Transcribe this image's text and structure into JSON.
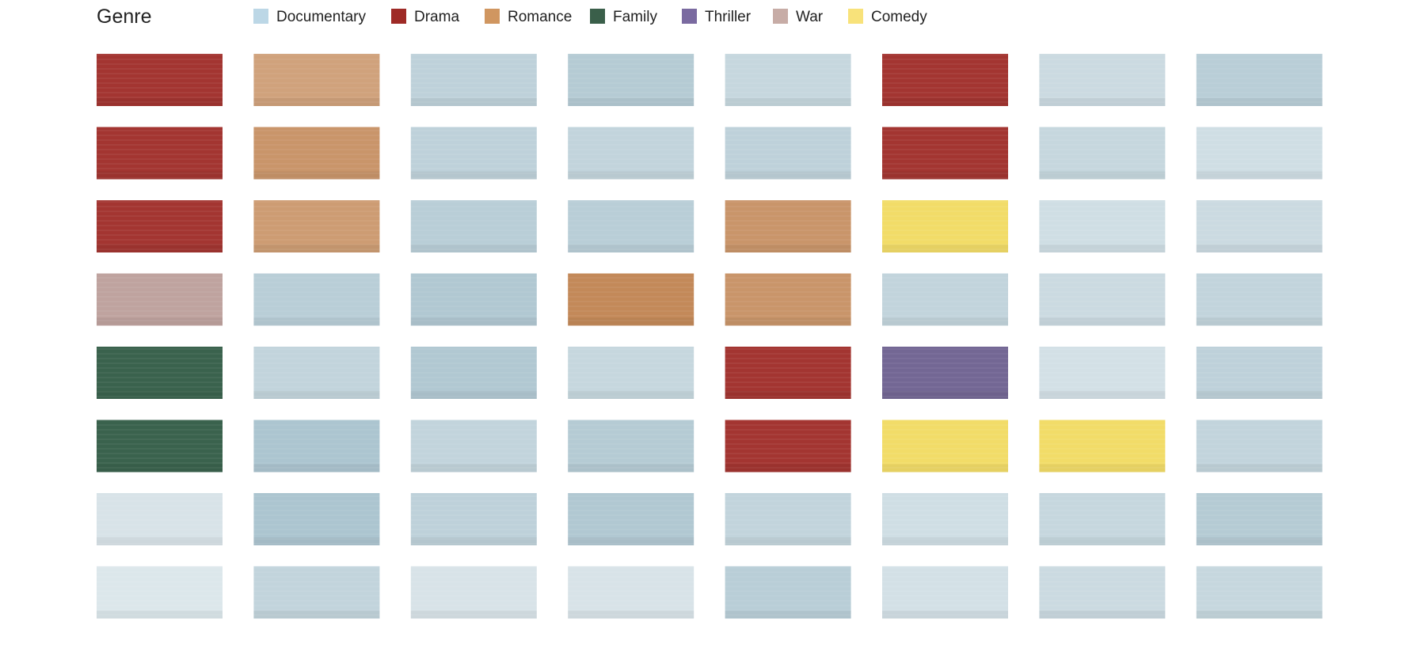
{
  "chart_data": {
    "type": "heatmap",
    "title": "",
    "legend": {
      "title": "Genre",
      "placement": "top-left",
      "entries": [
        {
          "name": "Documentary",
          "color": "#bcd7e6"
        },
        {
          "name": "Drama",
          "color": "#9e2a26"
        },
        {
          "name": "Romance",
          "color": "#d09660"
        },
        {
          "name": "Family",
          "color": "#3a5f4a"
        },
        {
          "name": "Thriller",
          "color": "#7a6aa0"
        },
        {
          "name": "War",
          "color": "#c7aca6"
        },
        {
          "name": "Comedy",
          "color": "#f8e27a"
        }
      ]
    },
    "grid": {
      "rows": 8,
      "columns": 8,
      "cells": [
        [
          "Drama",
          "Romance",
          "Documentary",
          "Documentary",
          "Documentary",
          "Drama",
          "Documentary",
          "Documentary"
        ],
        [
          "Drama",
          "Romance",
          "Documentary",
          "Documentary",
          "Documentary",
          "Drama",
          "Documentary",
          "Documentary"
        ],
        [
          "Drama",
          "Romance",
          "Documentary",
          "Documentary",
          "Romance",
          "Comedy",
          "Documentary",
          "Documentary"
        ],
        [
          "War",
          "Documentary",
          "Documentary",
          "Romance",
          "Romance",
          "Documentary",
          "Documentary",
          "Documentary"
        ],
        [
          "Family",
          "Documentary",
          "Documentary",
          "Documentary",
          "Drama",
          "Thriller",
          "Documentary",
          "Documentary"
        ],
        [
          "Family",
          "Documentary",
          "Documentary",
          "Documentary",
          "Drama",
          "Comedy",
          "Comedy",
          "Documentary"
        ],
        [
          "Documentary",
          "Documentary",
          "Documentary",
          "Documentary",
          "Documentary",
          "Documentary",
          "Documentary",
          "Documentary"
        ],
        [
          "Documentary",
          "Documentary",
          "Documentary",
          "Documentary",
          "Documentary",
          "Documentary",
          "Documentary",
          "Documentary"
        ]
      ]
    },
    "palette": {
      "Documentary": "#a8c2cd",
      "Drama": "#9e2a26",
      "Romance": "#c08350",
      "Family": "#2f5a43",
      "Thriller": "#6c5f8e",
      "War": "#b89995",
      "Comedy": "#f0d64e"
    },
    "opacity": [
      [
        0.95,
        0.75,
        0.75,
        0.85,
        0.65,
        0.95,
        0.6,
        0.8
      ],
      [
        0.95,
        0.85,
        0.75,
        0.7,
        0.75,
        0.95,
        0.65,
        0.55
      ],
      [
        0.95,
        0.8,
        0.8,
        0.8,
        0.85,
        0.85,
        0.55,
        0.6
      ],
      [
        0.9,
        0.8,
        0.9,
        0.95,
        0.85,
        0.7,
        0.6,
        0.7
      ],
      [
        0.95,
        0.7,
        0.9,
        0.65,
        0.95,
        0.95,
        0.5,
        0.75
      ],
      [
        0.95,
        0.95,
        0.7,
        0.85,
        0.95,
        0.85,
        0.85,
        0.7
      ],
      [
        0.45,
        0.95,
        0.75,
        0.9,
        0.7,
        0.55,
        0.65,
        0.85
      ],
      [
        0.4,
        0.7,
        0.45,
        0.45,
        0.8,
        0.5,
        0.6,
        0.65
      ]
    ]
  }
}
